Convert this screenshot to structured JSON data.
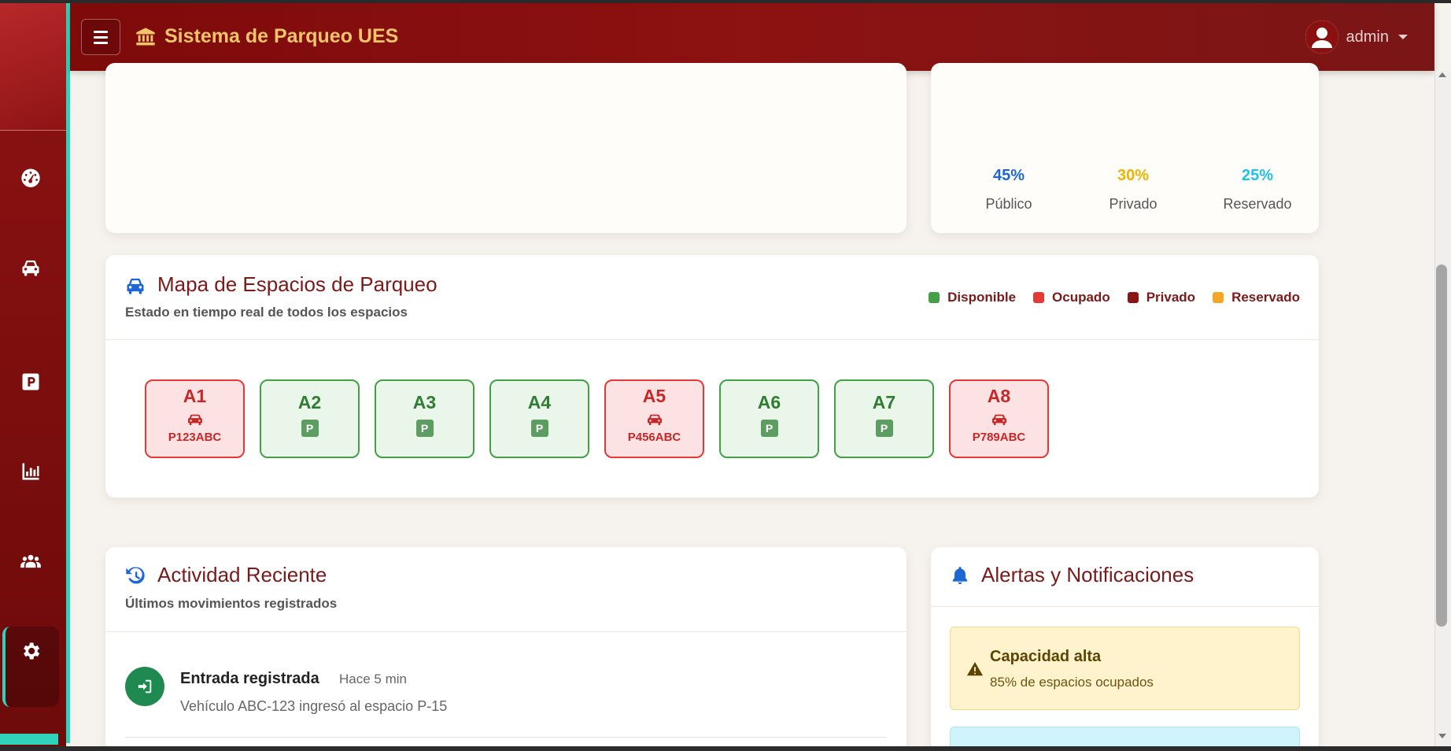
{
  "header": {
    "title": "Sistema de Parqueo UES",
    "user": "admin"
  },
  "sidebar": {
    "items": [
      {
        "icon": "tachometer-icon"
      },
      {
        "icon": "car-icon"
      },
      {
        "icon": "parking-icon"
      },
      {
        "icon": "chart-bar-icon"
      },
      {
        "icon": "users-icon"
      },
      {
        "icon": "gear-icon",
        "active": true
      }
    ]
  },
  "distribution": {
    "items": [
      {
        "value": "45%",
        "label": "Público",
        "color": "#1d66d6"
      },
      {
        "value": "30%",
        "label": "Privado",
        "color": "#f0b400"
      },
      {
        "value": "25%",
        "label": "Reservado",
        "color": "#1fc2e8"
      }
    ]
  },
  "map": {
    "title": "Mapa de Espacios de Parqueo",
    "subtitle": "Estado en tiempo real de todos los espacios",
    "legend": [
      {
        "label": "Disponible",
        "color": "#43a047"
      },
      {
        "label": "Ocupado",
        "color": "#e53935"
      },
      {
        "label": "Privado",
        "color": "#8b1414"
      },
      {
        "label": "Reservado",
        "color": "#f5a623"
      }
    ],
    "spaces": [
      {
        "code": "A1",
        "status": "ocupado",
        "plate": "P123ABC"
      },
      {
        "code": "A2",
        "status": "disponible",
        "badge": "P"
      },
      {
        "code": "A3",
        "status": "disponible",
        "badge": "P"
      },
      {
        "code": "A4",
        "status": "disponible",
        "badge": "P"
      },
      {
        "code": "A5",
        "status": "ocupado",
        "plate": "P456ABC"
      },
      {
        "code": "A6",
        "status": "disponible",
        "badge": "P"
      },
      {
        "code": "A7",
        "status": "disponible",
        "badge": "P"
      },
      {
        "code": "A8",
        "status": "ocupado",
        "plate": "P789ABC"
      }
    ]
  },
  "activity": {
    "title": "Actividad Reciente",
    "subtitle": "Últimos movimientos registrados",
    "entries": [
      {
        "title": "Entrada registrada",
        "time": "Hace 5 min",
        "desc": "Vehículo ABC-123 ingresó al espacio P-15"
      }
    ]
  },
  "alerts": {
    "title": "Alertas y Notificaciones",
    "items": [
      {
        "title": "Capacidad alta",
        "desc": "85% de espacios ocupados",
        "type": "warning"
      }
    ]
  }
}
